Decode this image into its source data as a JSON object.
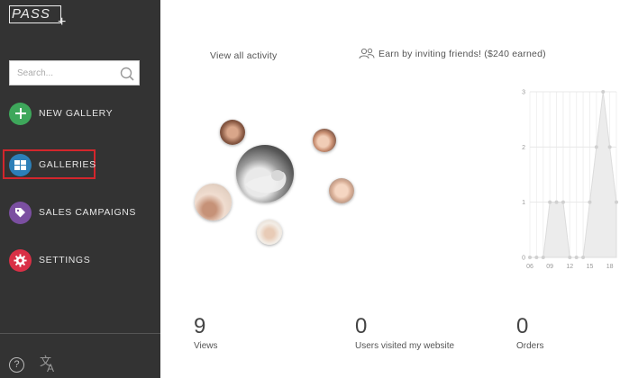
{
  "app": {
    "logo_text": "PASS"
  },
  "search": {
    "placeholder": "Search..."
  },
  "nav": {
    "new_gallery": "NEW GALLERY",
    "galleries": "GALLERIES",
    "sales_campaigns": "SALES CAMPAIGNS",
    "settings": "SETTINGS"
  },
  "colors": {
    "sidebar_bg": "#333333",
    "new_gallery": "#3ea75b",
    "galleries": "#2c7fb8",
    "sales_campaigns": "#7b4fa1",
    "settings": "#d93046",
    "highlight": "#d3262c"
  },
  "icons": [
    "search-icon",
    "plus-icon",
    "grid-icon",
    "tag-icon",
    "gear-icon",
    "help-icon",
    "translate-icon",
    "people-icon"
  ],
  "header": {
    "view_all_activity": "View all activity",
    "invite": "Earn by inviting friends! ($240 earned)"
  },
  "stats": [
    {
      "value": "9",
      "label": "Views"
    },
    {
      "value": "0",
      "label": "Users visited my website"
    },
    {
      "value": "0",
      "label": "Orders"
    }
  ],
  "chart_data": {
    "type": "area",
    "x_tick_labels": [
      "06",
      "09",
      "12",
      "15",
      "18"
    ],
    "y_tick_labels": [
      "0",
      "1",
      "2",
      "3"
    ],
    "ylim": [
      0,
      3
    ],
    "x": [
      6,
      7,
      8,
      9,
      10,
      11,
      12,
      13,
      14,
      15,
      16,
      17,
      18,
      19
    ],
    "values": [
      0,
      0,
      0,
      1,
      1,
      1,
      0,
      0,
      0,
      1,
      2,
      3,
      2,
      1
    ],
    "grid": true
  }
}
